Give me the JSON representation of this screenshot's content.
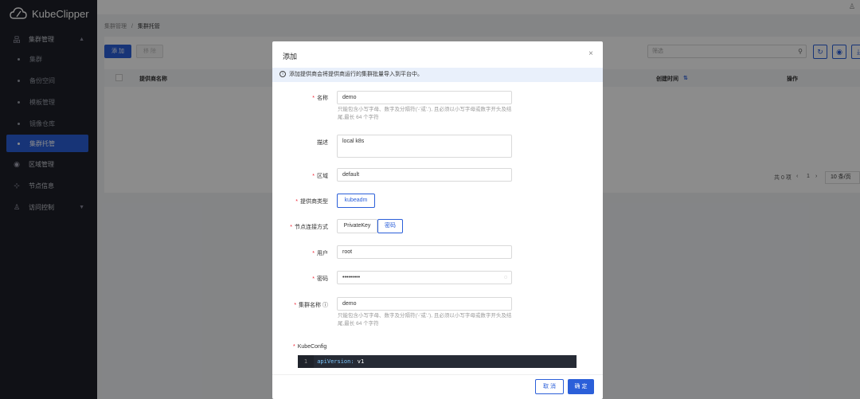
{
  "app": {
    "name": "KubeClipper"
  },
  "sidebar": {
    "groups": [
      {
        "label": "集群管理",
        "icon": "cluster-icon",
        "expanded": true
      },
      {
        "label": "区域管理",
        "icon": "region-icon"
      },
      {
        "label": "节点信息",
        "icon": "node-icon"
      },
      {
        "label": "访问控制",
        "icon": "user-icon"
      }
    ],
    "items": [
      {
        "label": "集群"
      },
      {
        "label": "备份空间"
      },
      {
        "label": "模板管理"
      },
      {
        "label": "镜像仓库"
      },
      {
        "label": "集群托管"
      }
    ]
  },
  "breadcrumb": {
    "parent": "集群管理",
    "sep": "/",
    "current": "集群托管"
  },
  "toolbar": {
    "add_label": "添 加",
    "move_label": "移 除",
    "search_placeholder": "筛选"
  },
  "table": {
    "headers": [
      "提供商名称",
      "创建时间",
      "操作"
    ],
    "sort_icon": "⇅"
  },
  "pagination": {
    "total": "共 0 项",
    "prev": "‹",
    "page": "1",
    "next": "›",
    "page_size": "10 条/页"
  },
  "modal": {
    "title": "添加",
    "close": "×",
    "info": "添加提供商会将提供商运行的集群批量导入到平台中。",
    "fields": {
      "name_label": "名称",
      "name_value": "demo",
      "name_hint": "只能包含小写字母、数字及分隔符('-'或'.'), 且必须以小写字母或数字开头及结尾,最长 64 个字符",
      "desc_label": "描述",
      "desc_value": "local k8s",
      "region_label": "区域",
      "region_value": "default",
      "provider_type_label": "提供商类型",
      "provider_type_value": "kubeadm",
      "conn_label": "节点连接方式",
      "conn_opt1": "PrivateKey",
      "conn_opt2": "密码",
      "user_label": "用户",
      "user_value": "root",
      "password_label": "密码",
      "password_value": "•••••••••",
      "cluster_name_label": "集群名称",
      "cluster_name_value": "demo",
      "cluster_name_hint": "只能包含小写字母、数字及分隔符('-'或'.'), 且必须以小写字母或数字开头及结尾,最长 64 个字符",
      "kubeconfig_label": "KubeConfig",
      "code_line_no": "1",
      "code_key": "apiVersion:",
      "code_val": " v1"
    },
    "cancel_label": "取 消",
    "ok_label": "确 定"
  },
  "colors": {
    "primary": "#2b5fd9",
    "sidebar_bg": "#1e2028",
    "required": "#e23"
  }
}
